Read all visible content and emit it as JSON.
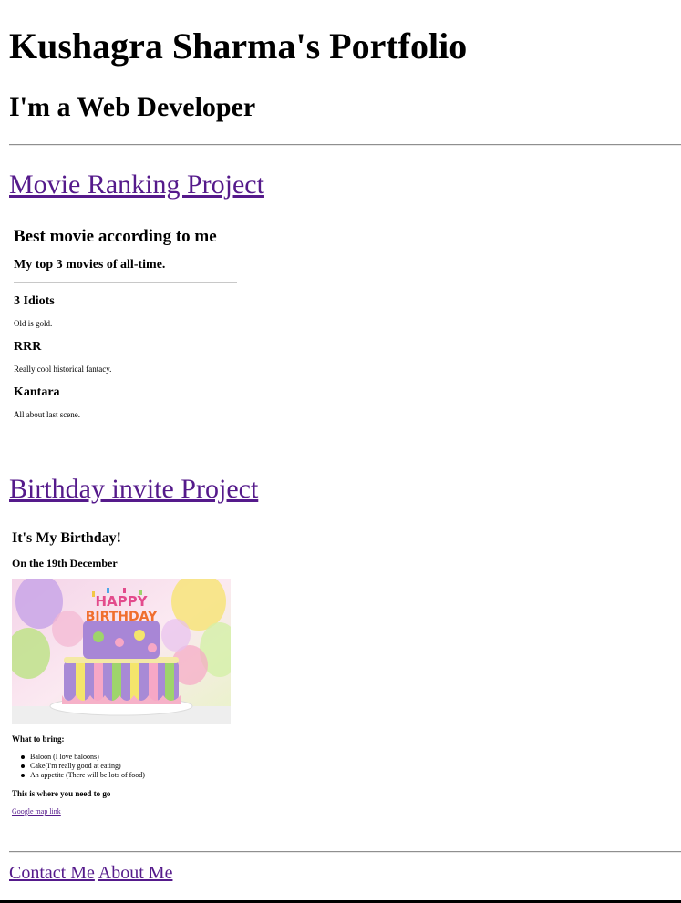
{
  "header": {
    "title": "Kushagra Sharma's Portfolio",
    "subtitle": "I'm a Web Developer"
  },
  "projects": {
    "movie_link": "Movie Ranking Project",
    "birthday_link": "Birthday invite Project"
  },
  "movie_ranking": {
    "heading": "Best movie according to me",
    "subheading": "My top 3 movies of all-time.",
    "items": [
      {
        "title": "3 Idiots",
        "description": "Old is gold."
      },
      {
        "title": "RRR",
        "description": "Really cool historical fantacy."
      },
      {
        "title": "Kantara",
        "description": "All about last scene."
      }
    ]
  },
  "birthday_invite": {
    "heading": "It's My Birthday!",
    "date": "On the 19th December",
    "cake_topper": "HAPPY BIRTHDAY",
    "what_to_bring_heading": "What to bring:",
    "bring_items": [
      "Baloon (I love baloons)",
      "Cake(I'm really good at eating)",
      "An appetite (There will be lots of food)"
    ],
    "where_heading": "This is where you need to go",
    "map_link": "Google map link"
  },
  "footer": {
    "contact": "Contact Me",
    "about": "About Me"
  },
  "colors": {
    "link": "#551a8b",
    "text": "#000000",
    "background": "#ffffff"
  }
}
